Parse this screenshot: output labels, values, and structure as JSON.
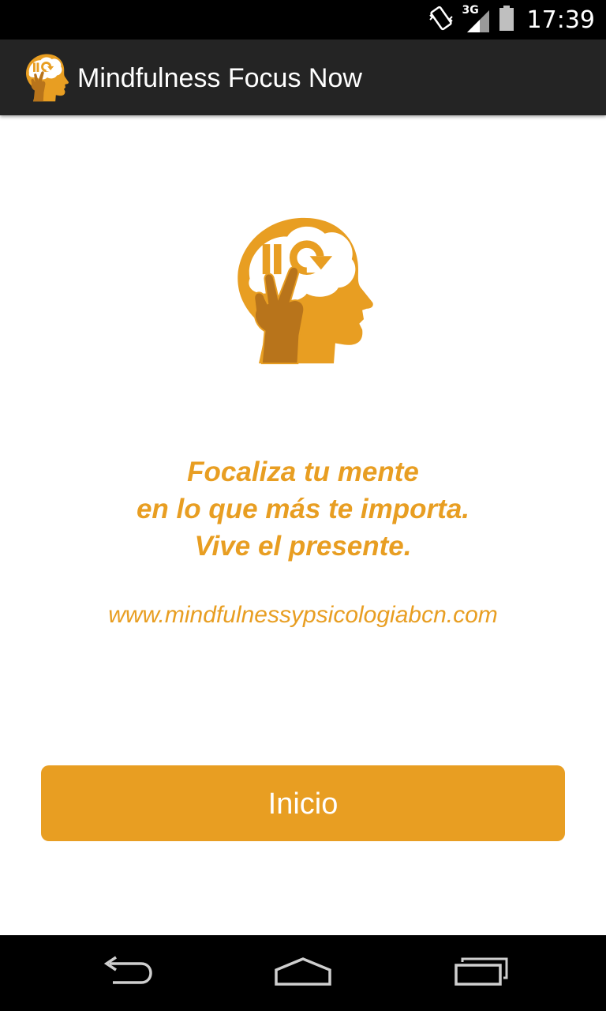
{
  "status_bar": {
    "network_label": "3G",
    "time": "17:39",
    "icons": [
      "vibrate-icon",
      "signal-icon",
      "battery-icon"
    ]
  },
  "action_bar": {
    "title": "Mindfulness Focus Now",
    "icon": "app-logo-icon"
  },
  "main": {
    "logo": "mind-head-logo",
    "tagline": {
      "line1": "Focaliza tu mente",
      "line2": "en lo que más te importa.",
      "line3": "Vive el presente."
    },
    "website": "www.mindfulnessypsicologiabcn.com",
    "start_button_label": "Inicio"
  },
  "nav_bar": {
    "items": [
      "back-icon",
      "home-icon",
      "recents-icon"
    ]
  },
  "colors": {
    "accent": "#e89e22",
    "accent_dark": "#b8741b",
    "action_bar": "#242424",
    "status_bar": "#000000",
    "background": "#ffffff"
  }
}
